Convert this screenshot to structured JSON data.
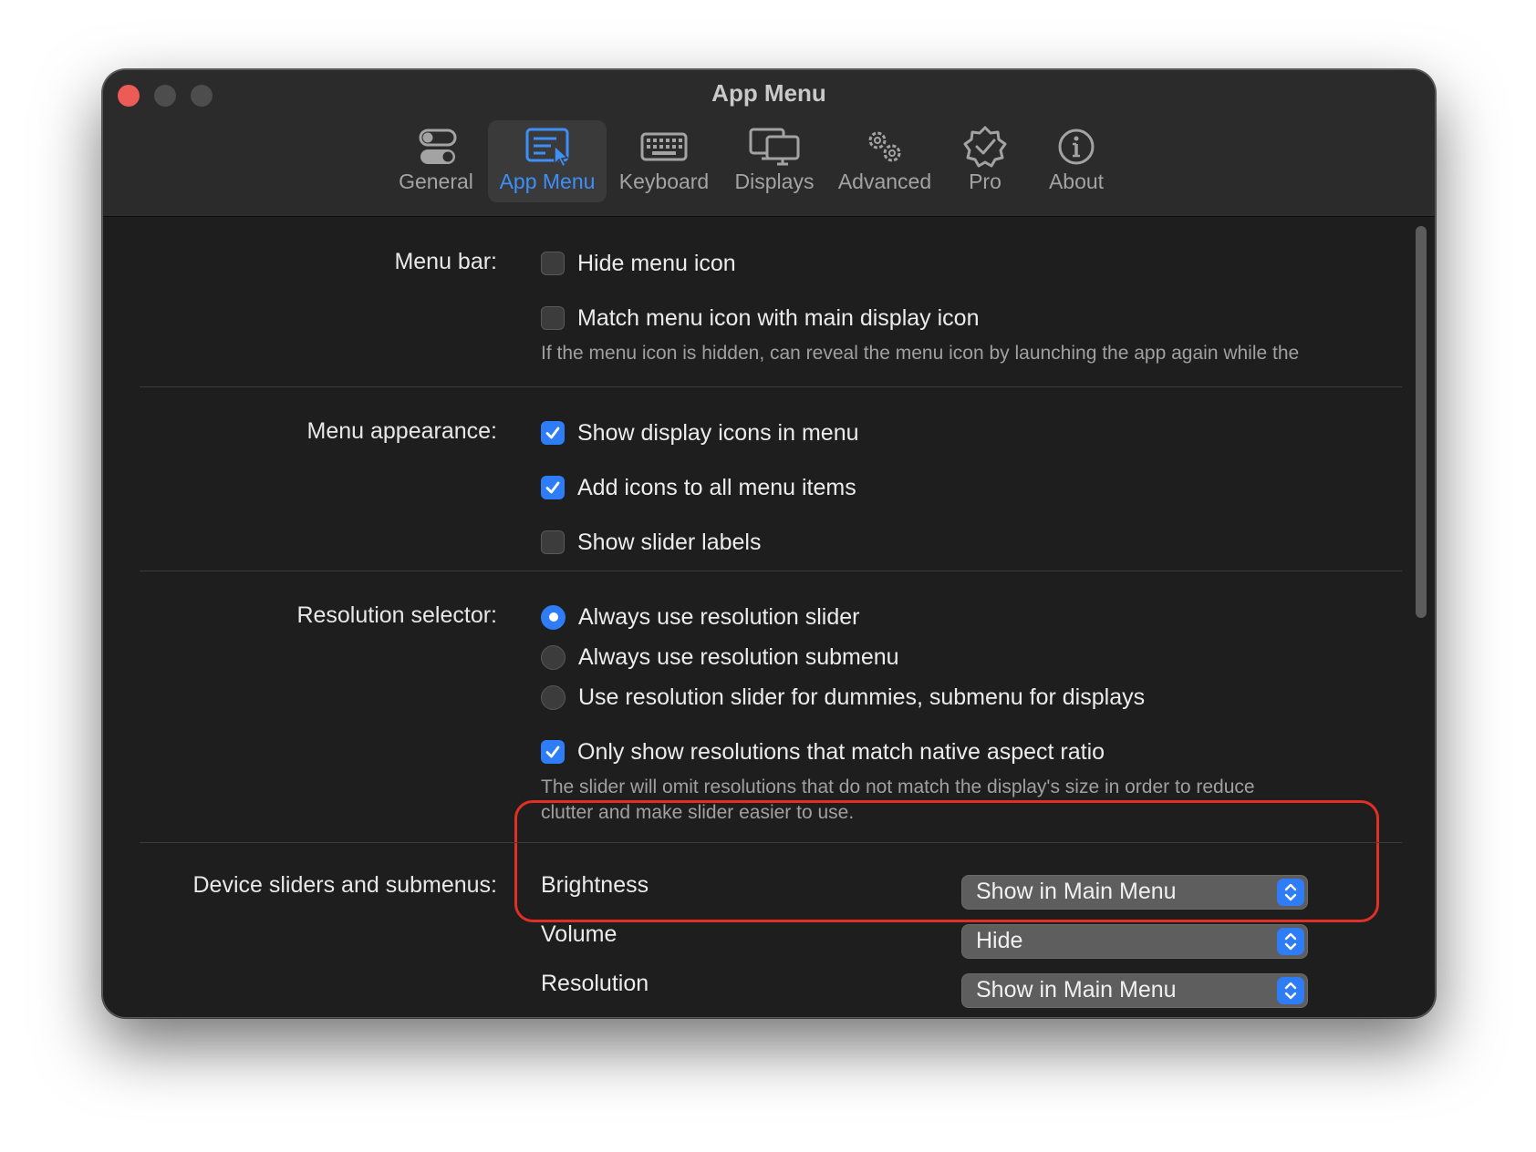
{
  "window": {
    "title": "App Menu"
  },
  "toolbar": {
    "tabs": [
      {
        "label": "General",
        "icon": "toggle-switches-icon",
        "active": false
      },
      {
        "label": "App Menu",
        "icon": "app-menu-icon",
        "active": true
      },
      {
        "label": "Keyboard",
        "icon": "keyboard-icon",
        "active": false
      },
      {
        "label": "Displays",
        "icon": "displays-icon",
        "active": false
      },
      {
        "label": "Advanced",
        "icon": "gears-icon",
        "active": false
      },
      {
        "label": "Pro",
        "icon": "pro-badge-icon",
        "active": false
      },
      {
        "label": "About",
        "icon": "info-icon",
        "active": false
      }
    ]
  },
  "menu_bar": {
    "label": "Menu bar:",
    "hide_menu_icon": {
      "label": "Hide menu icon",
      "checked": false
    },
    "match_menu_icon": {
      "label": "Match menu icon with main display icon",
      "checked": false
    },
    "note": "If the menu icon is hidden, can reveal the menu icon by launching the app again while the"
  },
  "menu_appearance": {
    "label": "Menu appearance:",
    "show_display_icons": {
      "label": "Show display icons in menu",
      "checked": true
    },
    "add_icons_all": {
      "label": "Add icons to all menu items",
      "checked": true
    },
    "show_slider_labels": {
      "label": "Show slider labels",
      "checked": false
    }
  },
  "resolution_selector": {
    "label": "Resolution selector:",
    "options": [
      {
        "label": "Always use resolution slider",
        "selected": true
      },
      {
        "label": "Always use resolution submenu",
        "selected": false
      },
      {
        "label": "Use resolution slider for dummies, submenu for displays",
        "selected": false
      }
    ],
    "native_aspect": {
      "label": "Only show resolutions that match native aspect ratio",
      "checked": true
    },
    "note_line1": "The slider will omit resolutions that do not match the display's size in order to reduce",
    "note_line2": "clutter and make slider easier to use."
  },
  "device_sliders": {
    "label": "Device sliders and submenus:",
    "rows": [
      {
        "label": "Brightness",
        "value": "Show in Main Menu"
      },
      {
        "label": "Volume",
        "value": "Hide"
      },
      {
        "label": "Resolution",
        "value": "Show in Main Menu"
      }
    ]
  },
  "colors": {
    "accent": "#2f7df6",
    "close": "#ec5b55",
    "highlight": "#e02f24"
  }
}
